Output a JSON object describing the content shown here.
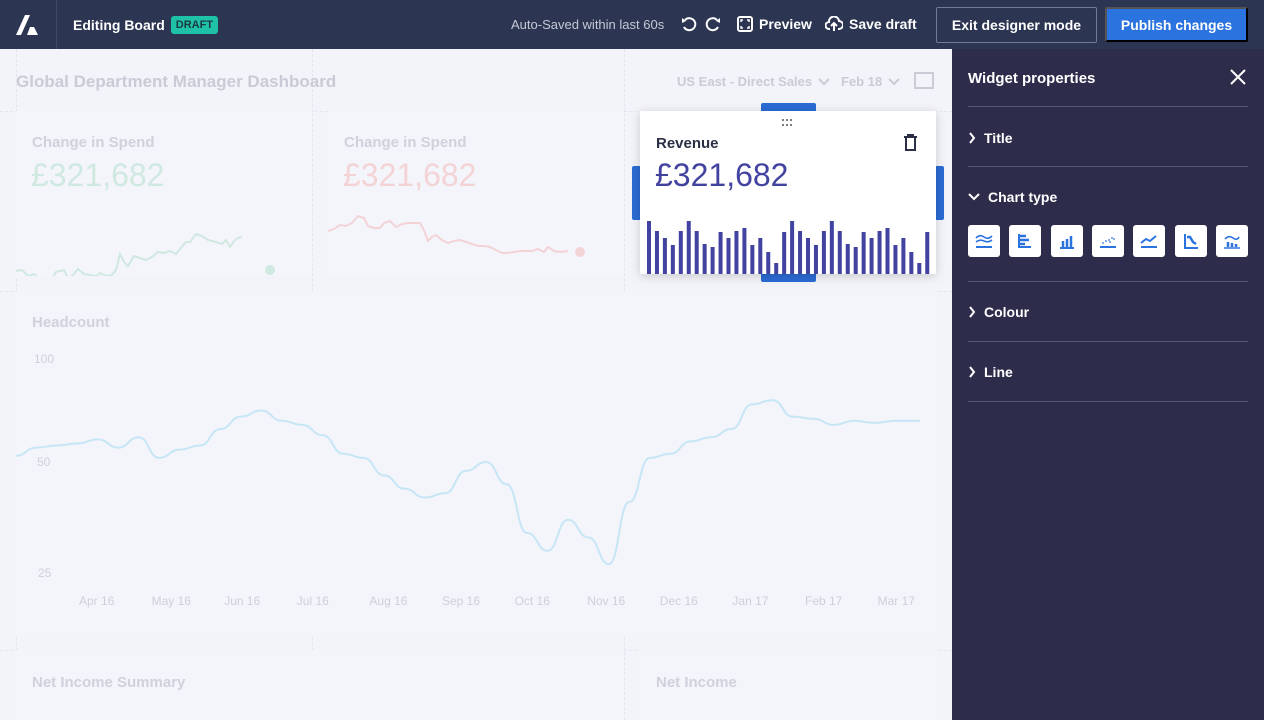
{
  "topbar": {
    "board_title": "Editing Board",
    "badge": "DRAFT",
    "autosave": "Auto-Saved within last 60s",
    "preview": "Preview",
    "save_draft": "Save draft",
    "exit": "Exit designer mode",
    "publish": "Publish changes"
  },
  "dashboard": {
    "title": "Global Department Manager Dashboard",
    "region_filter": "US East - Direct Sales",
    "date_filter": "Feb 18"
  },
  "tiles": {
    "spend_up": {
      "title": "Change in Spend",
      "value": "£321,682",
      "color": "#cfe8e0"
    },
    "spend_down": {
      "title": "Change in Spend",
      "value": "£321,682",
      "color": "#f3d3d6"
    },
    "revenue": {
      "title": "Revenue",
      "value": "£321,682",
      "bar_color": "#4242a0",
      "bars": [
        53,
        43,
        36,
        29,
        43,
        53,
        43,
        30,
        27,
        42,
        36,
        43,
        46,
        29,
        36,
        22,
        11,
        42,
        53,
        43,
        36,
        29,
        43,
        53,
        43,
        30,
        27,
        42,
        36,
        43,
        46,
        29,
        36,
        22,
        11,
        42
      ]
    },
    "net_income_summary": {
      "title": "Net Income Summary"
    },
    "net_income": {
      "title": "Net Income"
    }
  },
  "chart_data": {
    "type": "line",
    "title": "Headcount",
    "x": [
      "Apr 16",
      "May 16",
      "Jun 16",
      "Jul 16",
      "Aug 16",
      "Sep 16",
      "Oct 16",
      "Nov 16",
      "Dec 16",
      "Jan 17",
      "Feb 17",
      "Mar 17"
    ],
    "y_ticks": [
      "100",
      "50",
      "25"
    ],
    "series": [
      {
        "name": "Headcount",
        "color": "#c6e6f6",
        "values": [
          53,
          57,
          58,
          59,
          61,
          57,
          62,
          52,
          56,
          58,
          66,
          72,
          75,
          70,
          68,
          63,
          54,
          52,
          47,
          44,
          42,
          43,
          48,
          50,
          45,
          34,
          30,
          37,
          33,
          27,
          41,
          52,
          54,
          60,
          62,
          66,
          78,
          80,
          72,
          71,
          68,
          70,
          69,
          70,
          70,
          69
        ]
      }
    ],
    "ylim": [
      25,
      100
    ]
  },
  "props": {
    "title": "Widget properties",
    "sections": [
      "Title",
      "Chart type",
      "Colour",
      "Line"
    ],
    "chart_types": [
      "area-chart",
      "horizontal-bar-chart",
      "bar-chart",
      "scatter-chart",
      "line-chart",
      "step-chart",
      "combo-chart"
    ]
  }
}
